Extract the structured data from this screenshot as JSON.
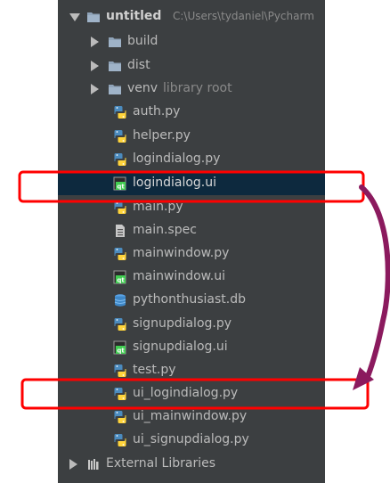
{
  "project": {
    "name": "untitled",
    "path": "C:\\Users\\tydaniel\\Pycharm"
  },
  "folders": {
    "build": "build",
    "dist": "dist",
    "venv": "venv",
    "venv_note": "library root"
  },
  "files": [
    {
      "name": "auth.py",
      "type": "python"
    },
    {
      "name": "helper.py",
      "type": "python"
    },
    {
      "name": "logindialog.py",
      "type": "python"
    },
    {
      "name": "logindialog.ui",
      "type": "qt-ui"
    },
    {
      "name": "main.py",
      "type": "python"
    },
    {
      "name": "main.spec",
      "type": "text"
    },
    {
      "name": "mainwindow.py",
      "type": "python"
    },
    {
      "name": "mainwindow.ui",
      "type": "qt-ui"
    },
    {
      "name": "pythonthusiast.db",
      "type": "database"
    },
    {
      "name": "signupdialog.py",
      "type": "python"
    },
    {
      "name": "signupdialog.ui",
      "type": "qt-ui"
    },
    {
      "name": "test.py",
      "type": "python"
    },
    {
      "name": "ui_logindialog.py",
      "type": "python"
    },
    {
      "name": "ui_mainwindow.py",
      "type": "python"
    },
    {
      "name": "ui_signupdialog.py",
      "type": "python"
    }
  ],
  "external_libraries": "External Libraries",
  "selected_file": "logindialog.ui",
  "annotation": {
    "highlight_color": "#ff0000",
    "arrow_color": "#8b1a5e",
    "highlighted_files": [
      "logindialog.ui",
      "ui_logindialog.py"
    ]
  }
}
